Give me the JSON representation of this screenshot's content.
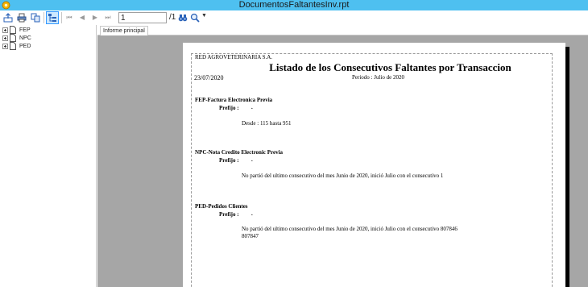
{
  "window": {
    "title": "DocumentosFaltantesInv.rpt"
  },
  "toolbar": {
    "buttons": [
      "export-icon",
      "print-icon",
      "copy-icon",
      "group-tree-icon",
      "first-page-icon",
      "previous-page-icon",
      "next-page-icon",
      "last-page-icon",
      "binoculars-icon",
      "zoom-icon"
    ],
    "page_input_value": "1",
    "page_total": "/1"
  },
  "tree": {
    "items": [
      {
        "label": "FEP"
      },
      {
        "label": "NPC"
      },
      {
        "label": "PED"
      }
    ]
  },
  "tabs": [
    {
      "label": "Informe principal"
    }
  ],
  "report": {
    "company": "RED AGROVETERINARIA S.A.",
    "title": "Listado de los Consecutivos Faltantes por Transaccion",
    "date": "23/07/2020",
    "period": "Periodo : Julio de 2020",
    "sections": [
      {
        "heading": "FEP-Factura Electronica Previa",
        "prefix_label": "Prefijo :",
        "prefix_value": ".",
        "detail": "Desde :   115 hasta  951",
        "detail2": ""
      },
      {
        "heading": "NPC-Nota Credito Electronic Previa",
        "prefix_label": "Prefijo :",
        "prefix_value": ".",
        "detail": "No partió del ultimo consecutivo del mes Junio de 2020, inició Julio con el consecutivo 1",
        "detail2": ""
      },
      {
        "heading": "PED-Pedidos Clientes",
        "prefix_label": "Prefijo :",
        "prefix_value": ".",
        "detail": "No partió del ultimo consecutivo del mes Junio de 2020, inició Julio con el consecutivo 807846",
        "detail2": "807847"
      }
    ]
  }
}
